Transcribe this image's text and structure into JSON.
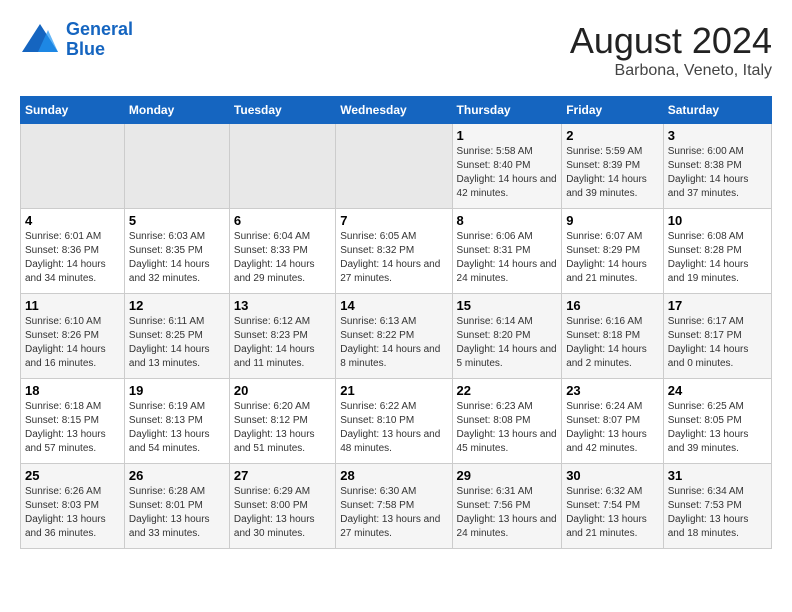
{
  "logo": {
    "line1": "General",
    "line2": "Blue"
  },
  "title": "August 2024",
  "subtitle": "Barbona, Veneto, Italy",
  "weekdays": [
    "Sunday",
    "Monday",
    "Tuesday",
    "Wednesday",
    "Thursday",
    "Friday",
    "Saturday"
  ],
  "weeks": [
    [
      {
        "day": "",
        "sunrise": "",
        "sunset": "",
        "daylight": ""
      },
      {
        "day": "",
        "sunrise": "",
        "sunset": "",
        "daylight": ""
      },
      {
        "day": "",
        "sunrise": "",
        "sunset": "",
        "daylight": ""
      },
      {
        "day": "",
        "sunrise": "",
        "sunset": "",
        "daylight": ""
      },
      {
        "day": "1",
        "sunrise": "Sunrise: 5:58 AM",
        "sunset": "Sunset: 8:40 PM",
        "daylight": "Daylight: 14 hours and 42 minutes."
      },
      {
        "day": "2",
        "sunrise": "Sunrise: 5:59 AM",
        "sunset": "Sunset: 8:39 PM",
        "daylight": "Daylight: 14 hours and 39 minutes."
      },
      {
        "day": "3",
        "sunrise": "Sunrise: 6:00 AM",
        "sunset": "Sunset: 8:38 PM",
        "daylight": "Daylight: 14 hours and 37 minutes."
      }
    ],
    [
      {
        "day": "4",
        "sunrise": "Sunrise: 6:01 AM",
        "sunset": "Sunset: 8:36 PM",
        "daylight": "Daylight: 14 hours and 34 minutes."
      },
      {
        "day": "5",
        "sunrise": "Sunrise: 6:03 AM",
        "sunset": "Sunset: 8:35 PM",
        "daylight": "Daylight: 14 hours and 32 minutes."
      },
      {
        "day": "6",
        "sunrise": "Sunrise: 6:04 AM",
        "sunset": "Sunset: 8:33 PM",
        "daylight": "Daylight: 14 hours and 29 minutes."
      },
      {
        "day": "7",
        "sunrise": "Sunrise: 6:05 AM",
        "sunset": "Sunset: 8:32 PM",
        "daylight": "Daylight: 14 hours and 27 minutes."
      },
      {
        "day": "8",
        "sunrise": "Sunrise: 6:06 AM",
        "sunset": "Sunset: 8:31 PM",
        "daylight": "Daylight: 14 hours and 24 minutes."
      },
      {
        "day": "9",
        "sunrise": "Sunrise: 6:07 AM",
        "sunset": "Sunset: 8:29 PM",
        "daylight": "Daylight: 14 hours and 21 minutes."
      },
      {
        "day": "10",
        "sunrise": "Sunrise: 6:08 AM",
        "sunset": "Sunset: 8:28 PM",
        "daylight": "Daylight: 14 hours and 19 minutes."
      }
    ],
    [
      {
        "day": "11",
        "sunrise": "Sunrise: 6:10 AM",
        "sunset": "Sunset: 8:26 PM",
        "daylight": "Daylight: 14 hours and 16 minutes."
      },
      {
        "day": "12",
        "sunrise": "Sunrise: 6:11 AM",
        "sunset": "Sunset: 8:25 PM",
        "daylight": "Daylight: 14 hours and 13 minutes."
      },
      {
        "day": "13",
        "sunrise": "Sunrise: 6:12 AM",
        "sunset": "Sunset: 8:23 PM",
        "daylight": "Daylight: 14 hours and 11 minutes."
      },
      {
        "day": "14",
        "sunrise": "Sunrise: 6:13 AM",
        "sunset": "Sunset: 8:22 PM",
        "daylight": "Daylight: 14 hours and 8 minutes."
      },
      {
        "day": "15",
        "sunrise": "Sunrise: 6:14 AM",
        "sunset": "Sunset: 8:20 PM",
        "daylight": "Daylight: 14 hours and 5 minutes."
      },
      {
        "day": "16",
        "sunrise": "Sunrise: 6:16 AM",
        "sunset": "Sunset: 8:18 PM",
        "daylight": "Daylight: 14 hours and 2 minutes."
      },
      {
        "day": "17",
        "sunrise": "Sunrise: 6:17 AM",
        "sunset": "Sunset: 8:17 PM",
        "daylight": "Daylight: 14 hours and 0 minutes."
      }
    ],
    [
      {
        "day": "18",
        "sunrise": "Sunrise: 6:18 AM",
        "sunset": "Sunset: 8:15 PM",
        "daylight": "Daylight: 13 hours and 57 minutes."
      },
      {
        "day": "19",
        "sunrise": "Sunrise: 6:19 AM",
        "sunset": "Sunset: 8:13 PM",
        "daylight": "Daylight: 13 hours and 54 minutes."
      },
      {
        "day": "20",
        "sunrise": "Sunrise: 6:20 AM",
        "sunset": "Sunset: 8:12 PM",
        "daylight": "Daylight: 13 hours and 51 minutes."
      },
      {
        "day": "21",
        "sunrise": "Sunrise: 6:22 AM",
        "sunset": "Sunset: 8:10 PM",
        "daylight": "Daylight: 13 hours and 48 minutes."
      },
      {
        "day": "22",
        "sunrise": "Sunrise: 6:23 AM",
        "sunset": "Sunset: 8:08 PM",
        "daylight": "Daylight: 13 hours and 45 minutes."
      },
      {
        "day": "23",
        "sunrise": "Sunrise: 6:24 AM",
        "sunset": "Sunset: 8:07 PM",
        "daylight": "Daylight: 13 hours and 42 minutes."
      },
      {
        "day": "24",
        "sunrise": "Sunrise: 6:25 AM",
        "sunset": "Sunset: 8:05 PM",
        "daylight": "Daylight: 13 hours and 39 minutes."
      }
    ],
    [
      {
        "day": "25",
        "sunrise": "Sunrise: 6:26 AM",
        "sunset": "Sunset: 8:03 PM",
        "daylight": "Daylight: 13 hours and 36 minutes."
      },
      {
        "day": "26",
        "sunrise": "Sunrise: 6:28 AM",
        "sunset": "Sunset: 8:01 PM",
        "daylight": "Daylight: 13 hours and 33 minutes."
      },
      {
        "day": "27",
        "sunrise": "Sunrise: 6:29 AM",
        "sunset": "Sunset: 8:00 PM",
        "daylight": "Daylight: 13 hours and 30 minutes."
      },
      {
        "day": "28",
        "sunrise": "Sunrise: 6:30 AM",
        "sunset": "Sunset: 7:58 PM",
        "daylight": "Daylight: 13 hours and 27 minutes."
      },
      {
        "day": "29",
        "sunrise": "Sunrise: 6:31 AM",
        "sunset": "Sunset: 7:56 PM",
        "daylight": "Daylight: 13 hours and 24 minutes."
      },
      {
        "day": "30",
        "sunrise": "Sunrise: 6:32 AM",
        "sunset": "Sunset: 7:54 PM",
        "daylight": "Daylight: 13 hours and 21 minutes."
      },
      {
        "day": "31",
        "sunrise": "Sunrise: 6:34 AM",
        "sunset": "Sunset: 7:53 PM",
        "daylight": "Daylight: 13 hours and 18 minutes."
      }
    ]
  ]
}
